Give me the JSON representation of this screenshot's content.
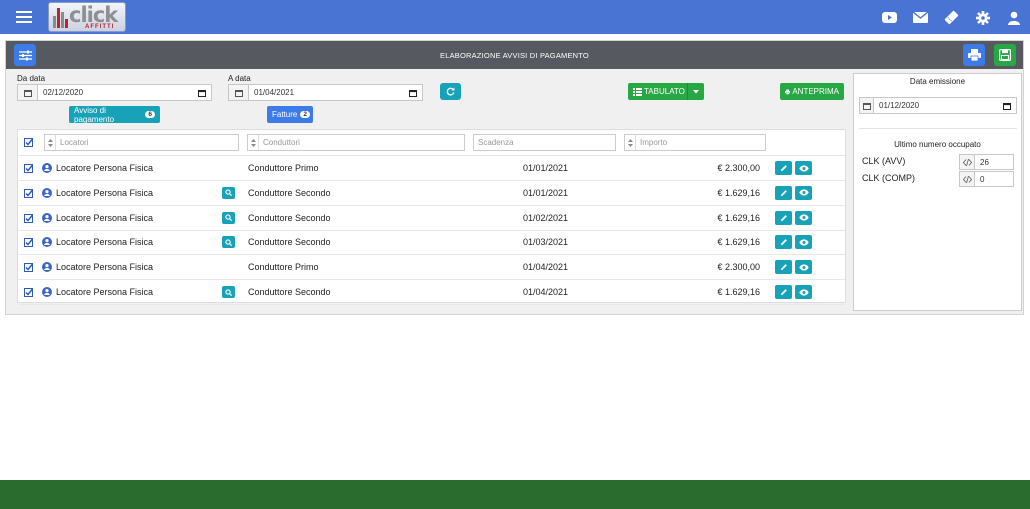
{
  "logo": {
    "text": "click",
    "subtext": "AFFITTI"
  },
  "header": {
    "icons": [
      "youtube-icon",
      "mail-icon",
      "ticket-icon",
      "gear-icon",
      "user-icon"
    ]
  },
  "panel": {
    "title": "ELABORAZIONE AVVISI DI PAGAMENTO"
  },
  "filters": {
    "from_label": "Da data",
    "from_value": "02/12/2020",
    "to_label": "A data",
    "to_value": "01/04/2021",
    "avvisi_label": "Avviso di pagamento",
    "avvisi_count": "6",
    "fatture_label": "Fatture",
    "fatture_count": "2",
    "tabulato_label": "TABULATO",
    "anteprima_label": "ANTEPRIMA"
  },
  "columns": {
    "locatori": "Locatori",
    "conduttori": "Conduttori",
    "scadenza": "Scadenza",
    "importo": "Importo"
  },
  "rows": [
    {
      "locatore": "Locatore Persona Fisica",
      "conduttore": "Conduttore Primo",
      "scadenza": "01/01/2021",
      "importo": "€ 2.300,00",
      "search": false
    },
    {
      "locatore": "Locatore Persona Fisica",
      "conduttore": "Conduttore Secondo",
      "scadenza": "01/01/2021",
      "importo": "€ 1.629,16",
      "search": true
    },
    {
      "locatore": "Locatore Persona Fisica",
      "conduttore": "Conduttore Secondo",
      "scadenza": "01/02/2021",
      "importo": "€ 1.629,16",
      "search": true
    },
    {
      "locatore": "Locatore Persona Fisica",
      "conduttore": "Conduttore Secondo",
      "scadenza": "01/03/2021",
      "importo": "€ 1.629,16",
      "search": true
    },
    {
      "locatore": "Locatore Persona Fisica",
      "conduttore": "Conduttore Primo",
      "scadenza": "01/04/2021",
      "importo": "€ 2.300,00",
      "search": false
    },
    {
      "locatore": "Locatore Persona Fisica",
      "conduttore": "Conduttore Secondo",
      "scadenza": "01/04/2021",
      "importo": "€ 1.629,16",
      "search": true
    }
  ],
  "side": {
    "emission_title": "Data emissione",
    "emission_value": "01/12/2020",
    "last_title": "Ultimo numero occupato",
    "clk_avv_label": "CLK (AVV)",
    "clk_avv_value": "26",
    "clk_comp_label": "CLK (COMP)",
    "clk_comp_value": "0"
  },
  "colors": {
    "topbar": "#4a74d4",
    "teal": "#17a2b8",
    "green": "#28a745",
    "primary": "#3d7be8",
    "footer": "#2a6b2e"
  }
}
